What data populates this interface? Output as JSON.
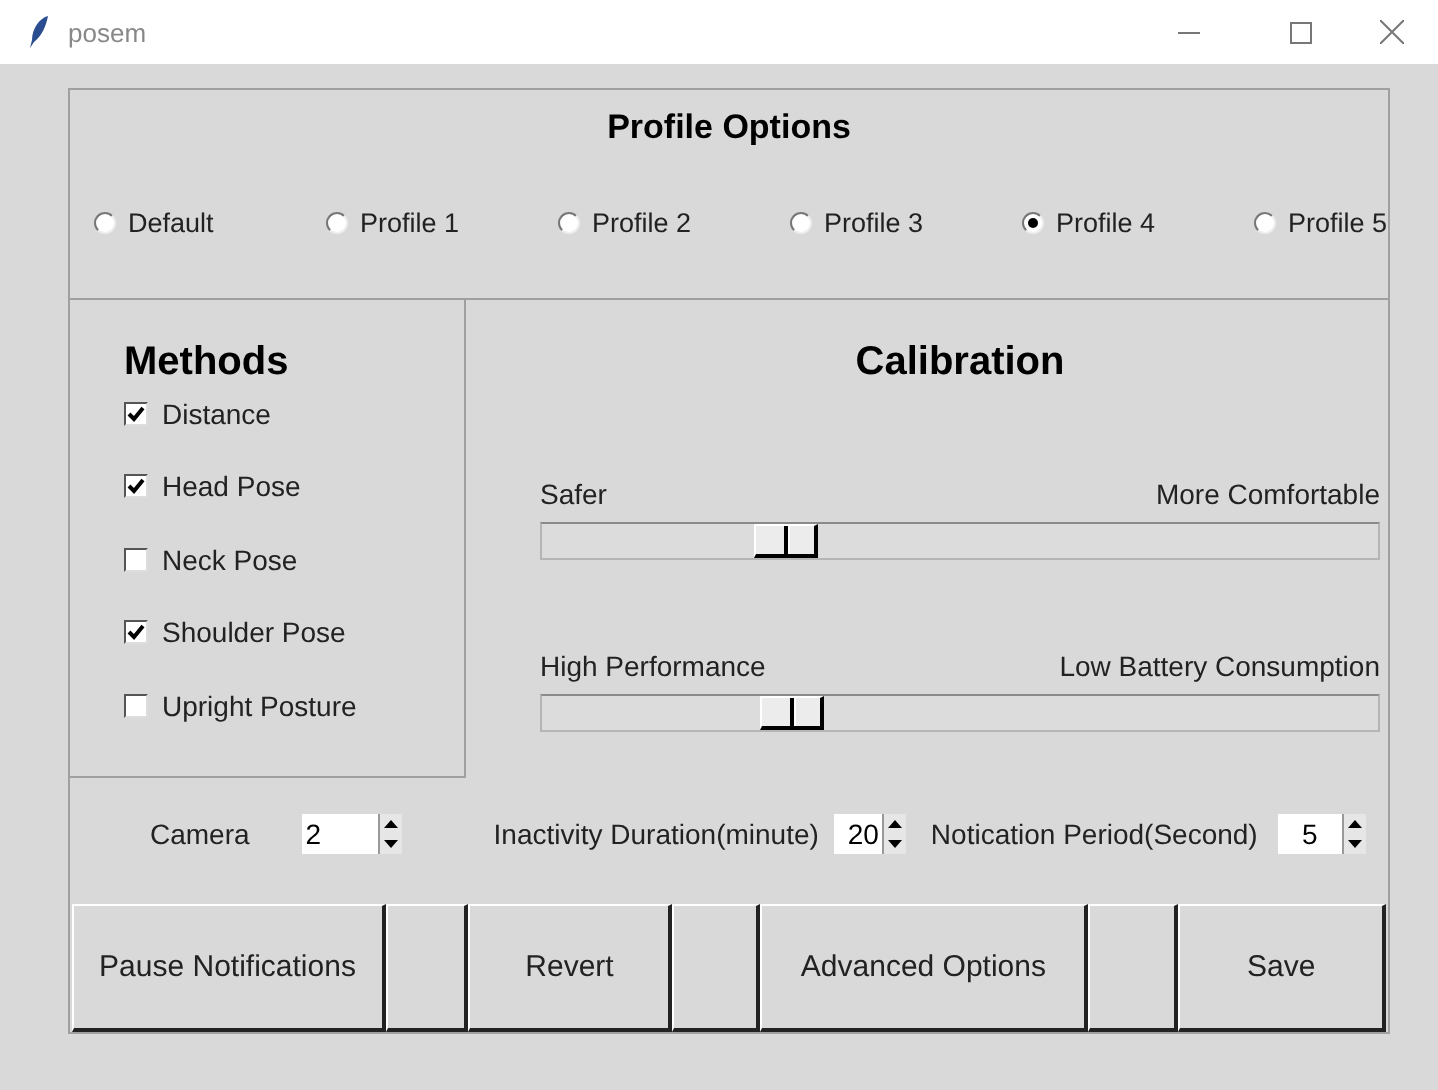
{
  "window": {
    "title": "posem"
  },
  "profile_options": {
    "title": "Profile Options",
    "profiles": [
      {
        "label": "Default",
        "selected": false
      },
      {
        "label": "Profile 1",
        "selected": false
      },
      {
        "label": "Profile 2",
        "selected": false
      },
      {
        "label": "Profile 3",
        "selected": false
      },
      {
        "label": "Profile 4",
        "selected": true
      },
      {
        "label": "Profile 5",
        "selected": false
      }
    ]
  },
  "methods": {
    "title": "Methods",
    "items": [
      {
        "label": "Distance",
        "checked": true
      },
      {
        "label": "Head Pose",
        "checked": true
      },
      {
        "label": "Neck Pose",
        "checked": false
      },
      {
        "label": "Shoulder Pose",
        "checked": true
      },
      {
        "label": "Upright Posture",
        "checked": false
      }
    ]
  },
  "calibration": {
    "title": "Calibration",
    "sliders": [
      {
        "left_label": "Safer",
        "right_label": "More Comfortable",
        "level": 0.275
      },
      {
        "left_label": "High Performance",
        "right_label": "Low Battery Consumption",
        "level": 0.283
      }
    ]
  },
  "settings": [
    {
      "label": "Camera",
      "value": "2"
    },
    {
      "label": "Inactivity Duration(minute)",
      "value": "20"
    },
    {
      "label": "Notication Period(Second)",
      "value": "5"
    }
  ],
  "buttons": [
    {
      "kind": "button",
      "label": "Pause Notifications"
    },
    {
      "kind": "blank"
    },
    {
      "kind": "button",
      "label": "Revert"
    },
    {
      "kind": "blank"
    },
    {
      "kind": "button",
      "label": "Advanced Options"
    },
    {
      "kind": "blank"
    },
    {
      "kind": "button",
      "label": "Save"
    }
  ]
}
